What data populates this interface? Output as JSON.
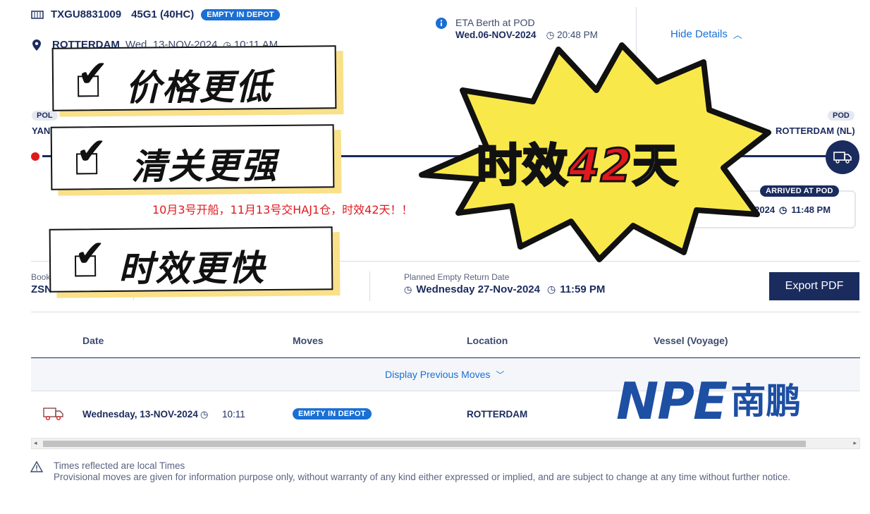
{
  "header": {
    "container_no": "TXGU8831009",
    "container_type": "45G1 (40HC)",
    "status_badge": "EMPTY IN DEPOT",
    "location": "ROTTERDAM",
    "location_date": "Wed. 13-NOV-2024",
    "location_time": "10:11 AM"
  },
  "eta": {
    "label": "ETA Berth at POD",
    "date": "Wed.06-NOV-2024",
    "time": "20:48 PM"
  },
  "hide_details": "Hide Details",
  "route": {
    "pol_tag": "POL",
    "pol_name": "YAN",
    "pod_tag": "POD",
    "pod_name": "ROTTERDAM (NL)",
    "arrived_badge": "ARRIVED AT POD",
    "arrived_date": "u 07-NOV-2024",
    "arrived_time": "11:48 PM"
  },
  "booking": {
    "label": "Book",
    "value": "ZSN"
  },
  "empty_return": {
    "label": "Planned Empty Return Date",
    "date": "Wednesday 27-Nov-2024",
    "time": "11:59 PM"
  },
  "export_pdf": "Export PDF",
  "table": {
    "headers": [
      "Date",
      "Moves",
      "Location",
      "Vessel (Voyage)"
    ],
    "display_previous": "Display Previous Moves",
    "rows": [
      {
        "date": "Wednesday, 13-NOV-2024",
        "time": "10:11",
        "move": "EMPTY IN DEPOT",
        "location": "ROTTERDAM",
        "vessel": ""
      }
    ]
  },
  "footer": {
    "line1": "Times reflected are local Times",
    "line2": "Provisional moves are given for information purpose only, without warranty of any kind either expressed or implied, and are subject to change at any time without further notice."
  },
  "promo": {
    "sticker1": "价格更低",
    "sticker2": "清关更强",
    "sticker3": "时效更快",
    "red_note": "10月3号开船，11月13号交HAJ1仓，时效42天！！",
    "burst_prefix": "时效",
    "burst_number": "42",
    "burst_suffix": "天",
    "logo_latin": "NPE",
    "logo_cn": "南鹏"
  },
  "colors": {
    "navy": "#1a2b5e",
    "accent_blue": "#1a6fd4",
    "burst_yellow": "#f9e84a",
    "sticker_shadow": "#f9e089",
    "promo_red": "#e0191f",
    "logo_blue": "#1d4fa3"
  }
}
